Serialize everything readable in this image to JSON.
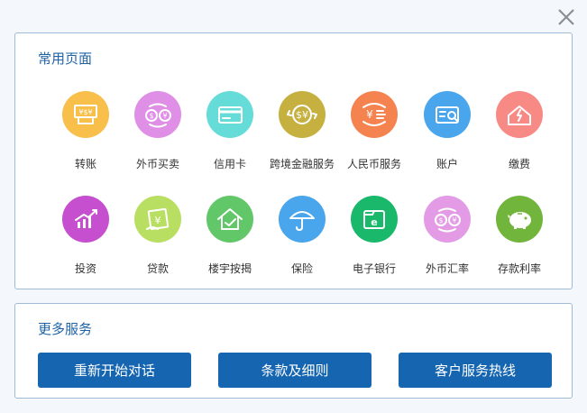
{
  "common_pages": {
    "title": "常用页面",
    "items": [
      {
        "label": "转账",
        "icon": "transfer-icon",
        "color": "#f8bf4b"
      },
      {
        "label": "外币买卖",
        "icon": "currency-exchange-icon",
        "color": "#df8fe6"
      },
      {
        "label": "信用卡",
        "icon": "credit-card-icon",
        "color": "#66dcd9"
      },
      {
        "label": "跨境金融服务",
        "icon": "cross-border-finance-icon",
        "color": "#c5b040"
      },
      {
        "label": "人民币服务",
        "icon": "rmb-service-icon",
        "color": "#f58350"
      },
      {
        "label": "账户",
        "icon": "account-icon",
        "color": "#49a5ec"
      },
      {
        "label": "缴费",
        "icon": "bill-payment-icon",
        "color": "#f88a86"
      },
      {
        "label": "投资",
        "icon": "investment-icon",
        "color": "#c54fcf"
      },
      {
        "label": "贷款",
        "icon": "loan-icon",
        "color": "#b9df62"
      },
      {
        "label": "楼宇按揭",
        "icon": "mortgage-icon",
        "color": "#61c768"
      },
      {
        "label": "保险",
        "icon": "insurance-icon",
        "color": "#49a5ec"
      },
      {
        "label": "电子银行",
        "icon": "e-banking-icon",
        "color": "#1ab86a"
      },
      {
        "label": "外币汇率",
        "icon": "exchange-rate-icon",
        "color": "#e39be6"
      },
      {
        "label": "存款利率",
        "icon": "deposit-rate-icon",
        "color": "#72b53c"
      }
    ]
  },
  "more_services": {
    "title": "更多服务",
    "buttons": [
      "重新开始对话",
      "条款及细则",
      "客户服务热线"
    ]
  }
}
